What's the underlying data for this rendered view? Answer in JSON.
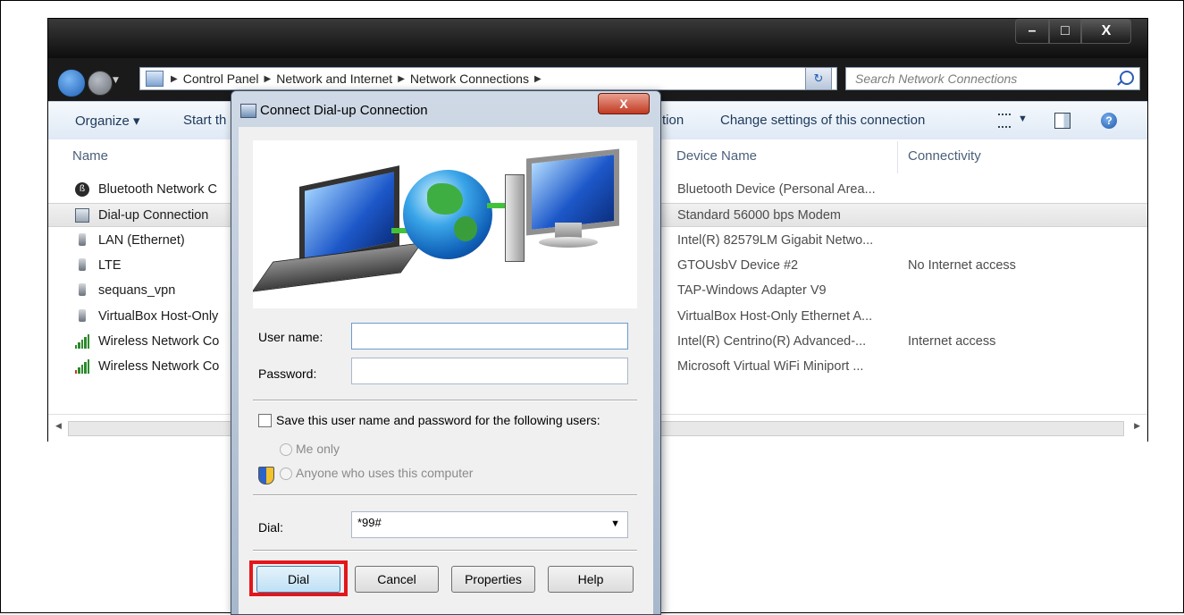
{
  "explorer": {
    "window_controls": {
      "minimize": "–",
      "maximize": "□",
      "close": "X"
    },
    "address": {
      "crumbs": [
        "Control Panel",
        "Network and Internet",
        "Network Connections"
      ]
    },
    "search": {
      "placeholder": "Search Network Connections"
    },
    "toolbar": {
      "organize": "Organize ▾",
      "start": "Start th",
      "partial": "tion",
      "change_settings": "Change settings of this connection"
    },
    "columns": {
      "name": "Name",
      "device": "Device Name",
      "connectivity": "Connectivity"
    },
    "rows": [
      {
        "name": "Bluetooth Network C",
        "device": "Bluetooth Device (Personal Area...",
        "connectivity": ""
      },
      {
        "name": "Dial-up Connection",
        "device": "Standard 56000 bps Modem",
        "connectivity": ""
      },
      {
        "name": "LAN (Ethernet)",
        "device": "Intel(R) 82579LM Gigabit Netwo...",
        "connectivity": ""
      },
      {
        "name": "LTE",
        "device": "GTOUsbV Device #2",
        "connectivity": "No Internet access"
      },
      {
        "name": "sequans_vpn",
        "device": "TAP-Windows Adapter V9",
        "connectivity": ""
      },
      {
        "name": "VirtualBox Host-Only",
        "device": "VirtualBox Host-Only Ethernet A...",
        "connectivity": ""
      },
      {
        "name": "Wireless Network Co",
        "device": "Intel(R) Centrino(R) Advanced-...",
        "connectivity": "Internet access"
      },
      {
        "name": "Wireless Network Co",
        "device": "Microsoft Virtual WiFi Miniport ...",
        "connectivity": ""
      }
    ],
    "selected_row": 1
  },
  "dialog": {
    "title": "Connect Dial-up Connection",
    "close": "X",
    "username": {
      "label": "User name:",
      "value": ""
    },
    "password": {
      "label": "Password:",
      "value": ""
    },
    "save_checkbox": {
      "label": "Save this user name and password for the following users:",
      "checked": false
    },
    "radio_me_only": "Me only",
    "radio_anyone": "Anyone who uses this computer",
    "dial": {
      "label": "Dial:",
      "value": "*99#"
    },
    "buttons": {
      "dial": "Dial",
      "cancel": "Cancel",
      "properties": "Properties",
      "help": "Help"
    }
  },
  "colors": {
    "highlight": "#e3161b",
    "toolbar_text": "#1e395b",
    "accent_blue": "#1d58c9"
  }
}
